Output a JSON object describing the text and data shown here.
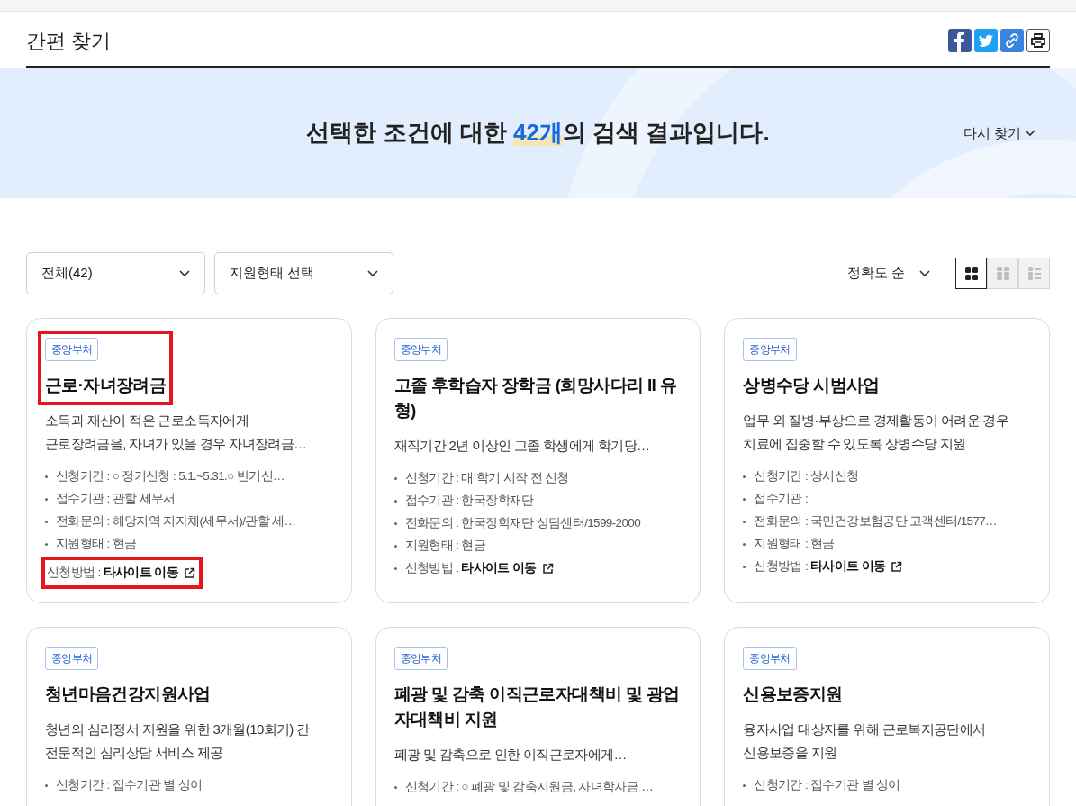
{
  "page_title": "간편 찾기",
  "share_buttons": [
    {
      "kind": "facebook"
    },
    {
      "kind": "twitter"
    },
    {
      "kind": "link"
    },
    {
      "kind": "print"
    }
  ],
  "banner": {
    "prefix": "선택한 조건에 대한 ",
    "count": "42개",
    "suffix": "의 검색 결과입니다.",
    "retry": "다시 찾기"
  },
  "filters": [
    {
      "value": "전체(42)"
    },
    {
      "value": "지원형태 선택"
    }
  ],
  "sort": "정확도 순",
  "view_modes": [
    {
      "kind": "grid",
      "selected": true
    },
    {
      "kind": "dense",
      "selected": false
    },
    {
      "kind": "list",
      "selected": false
    }
  ],
  "cards": [
    {
      "badge": "중앙부처",
      "title_lines": [
        "근로·자녀장려금"
      ],
      "description_lines": [
        "소득과 재산이 적은 근로소득자에게",
        "근로장려금을, 자녀가 있을 경우 자녀장려금…"
      ],
      "highlighted": true,
      "details": [
        {
          "label": "신청기간 :",
          "value": "○ 정기신청 : 5.1.~5.31.○ 반기신…"
        },
        {
          "label": "접수기관 :",
          "value": "관할 세무서"
        },
        {
          "label": "전화문의 :",
          "value": "해당지역 지자체(세무서)/관할 세…"
        },
        {
          "label": "지원형태 :",
          "value": "현금"
        },
        {
          "label": "신청방법 :",
          "value": "타사이트 이동",
          "kind": "link"
        }
      ]
    },
    {
      "badge": "중앙부처",
      "title_lines": [
        "고졸 후학습자 장학금 (희망사다리 II 유",
        "형)"
      ],
      "description_lines": [
        "재직기간 2년 이상인 고졸 학생에게 학기당…"
      ],
      "highlighted": false,
      "details": [
        {
          "label": "신청기간 :",
          "value": "매 학기 시작 전 신청"
        },
        {
          "label": "접수기관 :",
          "value": "한국장학재단"
        },
        {
          "label": "전화문의 :",
          "value": "한국장학재단 상담센터/1599-2000"
        },
        {
          "label": "지원형태 :",
          "value": "현금"
        },
        {
          "label": "신청방법 :",
          "value": "타사이트 이동",
          "kind": "link"
        }
      ]
    },
    {
      "badge": "중앙부처",
      "title_lines": [
        "상병수당 시범사업"
      ],
      "description_lines": [
        "업무 외 질병·부상으로 경제활동이 어려운 경우",
        "치료에 집중할 수 있도록 상병수당 지원"
      ],
      "highlighted": false,
      "details": [
        {
          "label": "신청기간 :",
          "value": "상시신청"
        },
        {
          "label": "접수기관 :"
        },
        {
          "label": "전화문의 :",
          "value": "국민건강보험공단 고객센터/1577…"
        },
        {
          "label": "지원형태 :",
          "value": "현금"
        },
        {
          "label": "신청방법 :",
          "value": "타사이트 이동",
          "kind": "link"
        }
      ]
    },
    {
      "badge": "중앙부처",
      "title_lines": [
        "청년마음건강지원사업"
      ],
      "description_lines": [
        "청년의 심리정서 지원을 위한 3개월(10회기) 간",
        "전문적인 심리상담 서비스 제공"
      ],
      "highlighted": false,
      "details": [
        {
          "label": "신청기간 :",
          "value": "접수기관 별 상이"
        }
      ]
    },
    {
      "badge": "중앙부처",
      "title_lines": [
        "폐광 및 감축 이직근로자대책비 및 광업",
        "자대책비 지원"
      ],
      "description_lines": [
        "폐광 및 감축으로 인한 이직근로자에게…"
      ],
      "highlighted": false,
      "details": [
        {
          "label": "신청기간 :",
          "value": "○ 폐광 및 감축지원금, 자녀학자금 …"
        }
      ]
    },
    {
      "badge": "중앙부처",
      "title_lines": [
        "신용보증지원"
      ],
      "description_lines": [
        "융자사업 대상자를 위해 근로복지공단에서",
        "신용보증을 지원"
      ],
      "highlighted": false,
      "details": [
        {
          "label": "신청기간 :",
          "value": "접수기관 별 상이"
        }
      ]
    }
  ]
}
